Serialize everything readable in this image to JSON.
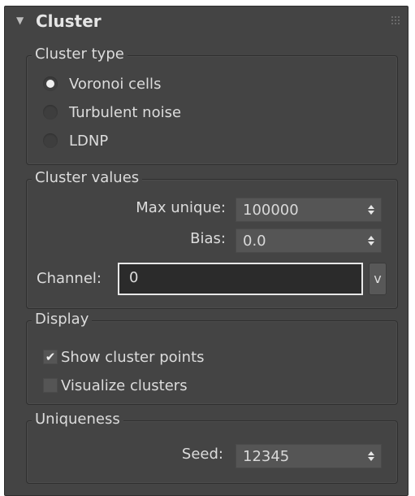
{
  "rollout": {
    "title": "Cluster",
    "collapse_icon": "triangle-down-icon",
    "grip_icon": "drag-grip-icon"
  },
  "cluster_type": {
    "title": "Cluster type",
    "options": [
      {
        "label": "Voronoi cells",
        "selected": true
      },
      {
        "label": "Turbulent noise",
        "selected": false
      },
      {
        "label": "LDNP",
        "selected": false
      }
    ]
  },
  "cluster_values": {
    "title": "Cluster values",
    "max_unique_label": "Max unique:",
    "max_unique_value": "100000",
    "bias_label": "Bias:",
    "bias_value": "0.0",
    "channel_label": "Channel:",
    "channel_value": "0",
    "channel_button": "v"
  },
  "display": {
    "title": "Display",
    "show_points_label": "Show cluster points",
    "show_points_checked": true,
    "visualize_label": "Visualize clusters",
    "visualize_checked": false,
    "check_glyph": "✔"
  },
  "uniqueness": {
    "title": "Uniqueness",
    "seed_label": "Seed:",
    "seed_value": "12345"
  }
}
